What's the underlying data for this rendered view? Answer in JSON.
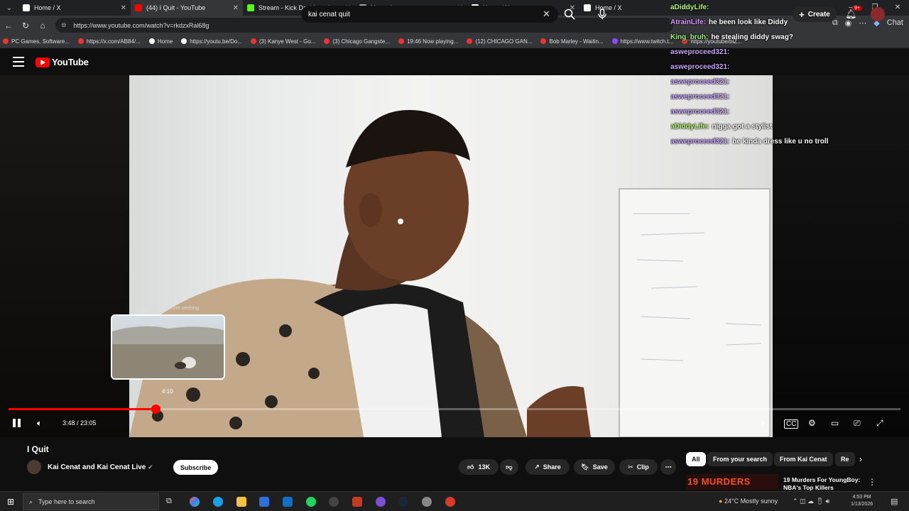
{
  "browser": {
    "tabs": [
      {
        "title": "Home / X",
        "icon": "x-icon",
        "color": "#ffffff",
        "active": false
      },
      {
        "title": "(44) I Quit - YouTube",
        "icon": "youtube-icon",
        "color": "#ff0000",
        "active": true
      },
      {
        "title": "Stream - Kick Dashboard",
        "icon": "kick-icon",
        "color": "#53fc18",
        "active": false
      },
      {
        "title": "New tab",
        "icon": "newtab-icon",
        "color": "#9aa0a6",
        "active": false
      },
      {
        "title": "Home / X",
        "icon": "x-icon",
        "color": "#ffffff",
        "active": false
      },
      {
        "title": "Home / X",
        "icon": "x-icon",
        "color": "#ffffff",
        "active": false
      }
    ],
    "url": "https://www.youtube.com/watch?v=rkdzxRal68g",
    "bookmarks": [
      "PC Games, Software...",
      "https://x.com/AB84/...",
      "Home",
      "https://youtu.be/Do...",
      "(3) Kanye West - Go...",
      "(3) Chicago Gangste...",
      "19:46 Now playing...",
      "(12) CHICAGO GAN...",
      "Bob Marley - Waitin...",
      "https://www.twitch.t...",
      "https://youtube/blZ..."
    ]
  },
  "youtube": {
    "logo_text": "YouTube",
    "search_query": "kai cenat quit",
    "create_label": "Create",
    "notification_count": "9+"
  },
  "chat": [
    {
      "user": "aDiddyLife:",
      "msg": "",
      "color": "#b9f27c"
    },
    {
      "user": "AtrainLife:",
      "msg": "he been look like Diddy",
      "color": "#d896ff"
    },
    {
      "user": "King_bruh:",
      "msg": "he stealing diddy swag?",
      "color": "#9cf57a"
    },
    {
      "user": "asweproceed321:",
      "msg": "",
      "color": "#c8a3ff"
    },
    {
      "user": "asweproceed321:",
      "msg": "",
      "color": "#c8a3ff"
    },
    {
      "user": "asweproceed321:",
      "msg": "",
      "color": "#c8a3ff"
    },
    {
      "user": "asweproceed321:",
      "msg": "",
      "color": "#c8a3ff"
    },
    {
      "user": "asweproceed321:",
      "msg": "",
      "color": "#c8a3ff"
    },
    {
      "user": "aDiddyLife:",
      "msg": "nigga got a stylist",
      "color": "#b9f27c"
    },
    {
      "user": "asweproceed321:",
      "msg": "he kinda dress like u no troll",
      "color": "#c8a3ff"
    }
  ],
  "player": {
    "seek_hint": "Pull up for precise seeking",
    "preview_time": "4:10",
    "current_time": "3:48 / 23:05",
    "progress_fraction": 0.1646
  },
  "video": {
    "title": "I Quit",
    "channel": "Kai Cenat and Kai Cenat Live",
    "subscribe_label": "Subscribe",
    "likes": "13K",
    "share_label": "Share",
    "save_label": "Save",
    "clip_label": "Clip"
  },
  "chips": [
    "All",
    "From your search",
    "From Kai Cenat",
    "Re"
  ],
  "recommendation": {
    "thumb_text": "19 MURDERS",
    "title": "19 Murders For YoungBoy: NBA's Top Killers"
  },
  "taskbar": {
    "search_placeholder": "Type here to search",
    "weather": "24°C  Mostly sunny",
    "time": "4:53 PM",
    "date": "1/13/2026"
  }
}
